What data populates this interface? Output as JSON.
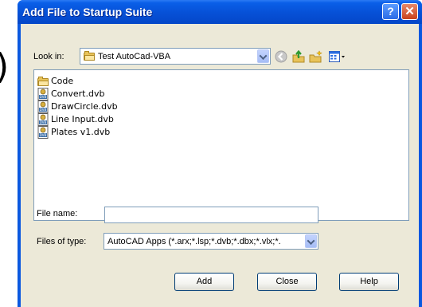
{
  "window": {
    "title": "Add File to Startup Suite"
  },
  "title_buttons": {
    "help": "?",
    "close": "✕"
  },
  "look_in": {
    "label": "Look in:",
    "value": "Test AutoCad-VBA"
  },
  "files": [
    {
      "name": "Code",
      "icon": "folder-icon"
    },
    {
      "name": "Convert.dvb",
      "icon": "dvb-file-icon"
    },
    {
      "name": "DrawCircle.dvb",
      "icon": "dvb-file-icon"
    },
    {
      "name": "Line Input.dvb",
      "icon": "dvb-file-icon"
    },
    {
      "name": "Plates v1.dvb",
      "icon": "dvb-file-icon"
    }
  ],
  "file_name": {
    "label": "File name:",
    "value": ""
  },
  "files_of_type": {
    "label": "Files of type:",
    "value": "AutoCAD Apps (*.arx;*.lsp;*.dvb;*.dbx;*.vlx;*."
  },
  "buttons": {
    "add": "Add",
    "close": "Close",
    "help": "Help"
  },
  "background": {
    "paren": ")"
  },
  "colors": {
    "titlebar": "#0a5fe8",
    "dialog_face": "#ece9d8",
    "field_border": "#7f9db9"
  }
}
